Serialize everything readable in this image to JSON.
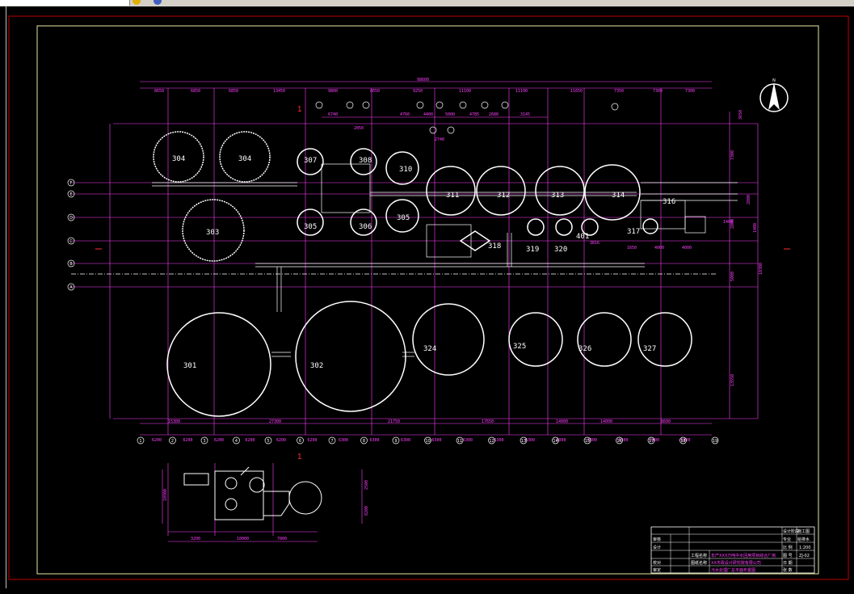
{
  "units": [
    {
      "id": "304a",
      "label": "304"
    },
    {
      "id": "304b",
      "label": "304"
    },
    {
      "id": "303",
      "label": "303"
    },
    {
      "id": "307",
      "label": "307"
    },
    {
      "id": "308",
      "label": "308"
    },
    {
      "id": "305a",
      "label": "305"
    },
    {
      "id": "306",
      "label": "306"
    },
    {
      "id": "310",
      "label": "310"
    },
    {
      "id": "305b",
      "label": "305"
    },
    {
      "id": "311",
      "label": "311"
    },
    {
      "id": "312",
      "label": "312"
    },
    {
      "id": "313",
      "label": "313"
    },
    {
      "id": "314",
      "label": "314"
    },
    {
      "id": "316",
      "label": "316"
    },
    {
      "id": "317",
      "label": "317"
    },
    {
      "id": "318",
      "label": "318"
    },
    {
      "id": "319",
      "label": "319"
    },
    {
      "id": "320",
      "label": "320"
    },
    {
      "id": "401",
      "label": "401"
    },
    {
      "id": "301",
      "label": "301"
    },
    {
      "id": "302",
      "label": "302"
    },
    {
      "id": "324",
      "label": "324"
    },
    {
      "id": "325",
      "label": "325"
    },
    {
      "id": "326",
      "label": "326"
    },
    {
      "id": "327",
      "label": "327"
    }
  ],
  "top_dimensions": [
    "8650",
    "6850",
    "6850",
    "13450",
    "9800",
    "8650",
    "9250",
    "11100",
    "11100",
    "11650",
    "7350",
    "7300",
    "7300"
  ],
  "top_total": "98600",
  "top_sub_dimensions": [
    "6740",
    "4760",
    "4400",
    "5000",
    "4785",
    "2680",
    "3145"
  ],
  "bottom_dimensions": [
    "6200",
    "6200",
    "6200",
    "6200",
    "6200",
    "6200",
    "6300",
    "6300",
    "6300",
    "6300",
    "6300",
    "6300",
    "6300",
    "6300",
    "6300",
    "6300",
    "6300",
    "6300"
  ],
  "bottom_group_dimensions": [
    "15300",
    "27300",
    "21750",
    "17650",
    "14000",
    "14000",
    "8600"
  ],
  "bottom_axes": [
    "1",
    "2",
    "3",
    "4",
    "5",
    "6",
    "7",
    "8",
    "9",
    "10",
    "11",
    "12",
    "13",
    "14",
    "15",
    "16",
    "17",
    "18",
    "19"
  ],
  "left_axes": [
    "F",
    "E",
    "D",
    "C",
    "B",
    "A"
  ],
  "right_dimensions": [
    "3650",
    "7300",
    "2800",
    "1400",
    "2800",
    "10300",
    "5000",
    "13550"
  ],
  "inset_dimensions": [
    "10900",
    "3200",
    "10000",
    "7800",
    "2500",
    "8200"
  ],
  "detail_dimensions": [
    "2740",
    "2050",
    "1650",
    "1400",
    "3816",
    "4000",
    "4000"
  ],
  "title_block": {
    "rows_left": [
      "审核",
      "设计",
      "校对",
      "审定"
    ],
    "project_label": "工程名称",
    "project_name": "年产XXX万吨中水回用项目综合厂房",
    "drawing_label": "图纸名称",
    "drawing_name": "污水处理厂总平面布置图",
    "company": "XX市政设计研究院有限公司",
    "scale_label": "比 例",
    "scale": "1:200",
    "code_label": "图 号",
    "code": "ZJ-02",
    "date_label": "日 期",
    "sheet_label": "张 数",
    "hdr1": "设计阶段",
    "hdr2": "施工图",
    "hdr3": "专业",
    "hdr4": "给排水"
  },
  "section_marks": [
    "1",
    "1"
  ],
  "north_label": "N"
}
